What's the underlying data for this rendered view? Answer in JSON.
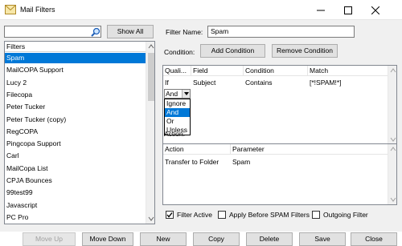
{
  "window": {
    "title": "Mail Filters"
  },
  "search": {
    "value": "",
    "show_all_label": "Show All"
  },
  "filters": {
    "header": "Filters",
    "items": [
      "Spam",
      "MailCOPA Support",
      "Lucy 2",
      "Filecopa",
      "Peter Tucker",
      "Peter Tucker (copy)",
      "RegCOPA",
      "Pingcopa Support",
      "Carl",
      "MailCopa List",
      "CPJA Bounces",
      "99test99",
      "Javascript",
      "PC Pro"
    ],
    "selected_index": 0
  },
  "filter_name": {
    "label": "Filter Name:",
    "value": "Spam"
  },
  "condition": {
    "label": "Condition:",
    "add_label": "Add Condition",
    "remove_label": "Remove Condition",
    "columns": [
      "Quali...",
      "Field",
      "Condition",
      "Match"
    ],
    "rows": [
      {
        "qualifier": "If",
        "field": "Subject",
        "condition": "Contains",
        "match": "[*!SPAM!*]"
      }
    ],
    "combo_value": "And",
    "dropdown_options": [
      "Ignore",
      "And",
      "Or",
      "Unless"
    ],
    "dropdown_selected": 1
  },
  "action": {
    "label": "Action:",
    "columns": [
      "Action",
      "Parameter"
    ],
    "rows": [
      {
        "action": "Transfer to Folder",
        "parameter": "Spam"
      }
    ]
  },
  "options": {
    "filter_active": {
      "label": "Filter Active",
      "checked": true
    },
    "apply_before_spam": {
      "label": "Apply Before SPAM Filters",
      "checked": false
    },
    "outgoing": {
      "label": "Outgoing Filter",
      "checked": false
    }
  },
  "buttons": {
    "move_up": "Move Up",
    "move_down": "Move Down",
    "new": "New",
    "copy": "Copy",
    "delete": "Delete",
    "save": "Save",
    "close": "Close"
  }
}
